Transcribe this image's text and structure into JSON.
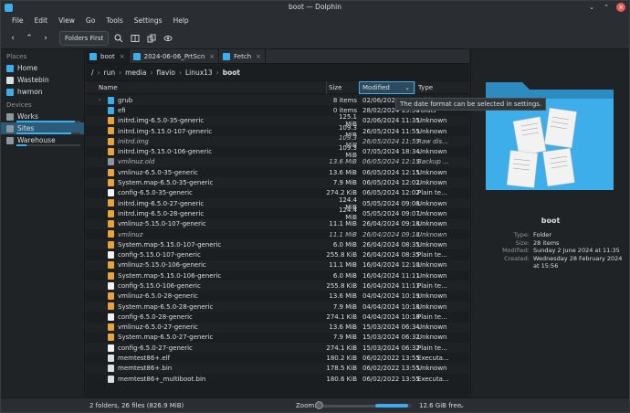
{
  "window": {
    "title": "boot — Dolphin"
  },
  "menu": [
    "File",
    "Edit",
    "View",
    "Go",
    "Tools",
    "Settings",
    "Help"
  ],
  "toolbar": {
    "folders_first_label": "Folders First"
  },
  "places": {
    "places_heading": "Places",
    "items": [
      {
        "label": "Home",
        "color": "#3daee9"
      },
      {
        "label": "Wastebin",
        "color": "#dcdfe2"
      },
      {
        "label": "hwmon",
        "color": "#3daee9"
      }
    ],
    "devices_heading": "Devices",
    "devices": [
      {
        "label": "Works",
        "usage": 0.92
      },
      {
        "label": "Sites",
        "usage": 0.85
      },
      {
        "label": "Warehouse",
        "usage": 0.15
      }
    ]
  },
  "tabs": [
    {
      "label": "boot"
    },
    {
      "label": "2024-06-06_PrtScn"
    },
    {
      "label": "Fetch"
    }
  ],
  "breadcrumb": [
    "/",
    "run",
    "media",
    "flavio",
    "Linux13",
    "boot"
  ],
  "columns": {
    "name": "Name",
    "size": "Size",
    "modified": "Modified",
    "type": "Type"
  },
  "tooltip": "The date format can be selected in settings.",
  "files": [
    {
      "name": "grub",
      "size": "8 items",
      "date": "02/06/2024 11:35",
      "type": "Folder",
      "kind": "folder",
      "dim": false,
      "expand": true
    },
    {
      "name": "efi",
      "size": "0 items",
      "date": "28/02/2024 15:56",
      "type": "Folder",
      "kind": "folder",
      "dim": false,
      "expand": false
    },
    {
      "name": "initrd.img-6.5.0-35-generic",
      "size": "125.1 MiB",
      "date": "02/06/2024 11:35",
      "type": "Unknown",
      "kind": "bin",
      "dim": false,
      "expand": false
    },
    {
      "name": "initrd.img-5.15.0-107-generic",
      "size": "109.3 MiB",
      "date": "26/05/2024 11:55",
      "type": "Unknown",
      "kind": "bin",
      "dim": false,
      "expand": false
    },
    {
      "name": "initrd.img",
      "size": "109.3 MiB",
      "date": "26/05/2024 11:55",
      "type": "Raw dis...",
      "kind": "bin",
      "dim": true,
      "expand": false
    },
    {
      "name": "initrd.img-5.15.0-106-generic",
      "size": "109.3 MiB",
      "date": "07/05/2024 18:34",
      "type": "Unknown",
      "kind": "bin",
      "dim": false,
      "expand": false
    },
    {
      "name": "vmlinuz.old",
      "size": "13.6 MiB",
      "date": "06/05/2024 12:15",
      "type": "Backup ...",
      "kind": "grey",
      "dim": true,
      "expand": false
    },
    {
      "name": "vmlinuz-6.5.0-35-generic",
      "size": "13.6 MiB",
      "date": "06/05/2024 12:15",
      "type": "Unknown",
      "kind": "bin",
      "dim": false,
      "expand": false
    },
    {
      "name": "System.map-6.5.0-35-generic",
      "size": "7.9 MiB",
      "date": "06/05/2024 12:02",
      "type": "Unknown",
      "kind": "bin",
      "dim": false,
      "expand": false
    },
    {
      "name": "config-6.5.0-35-generic",
      "size": "274.2 KiB",
      "date": "06/05/2024 12:02",
      "type": "Plain te...",
      "kind": "text",
      "dim": false,
      "expand": false
    },
    {
      "name": "initrd.img-6.5.0-27-generic",
      "size": "124.4 MiB",
      "date": "05/05/2024 09:08",
      "type": "Unknown",
      "kind": "bin",
      "dim": false,
      "expand": false
    },
    {
      "name": "initrd.img-6.5.0-28-generic",
      "size": "124.4 MiB",
      "date": "05/05/2024 09:07",
      "type": "Unknown",
      "kind": "bin",
      "dim": false,
      "expand": false
    },
    {
      "name": "vmlinuz-5.15.0-107-generic",
      "size": "11.1 MiB",
      "date": "26/04/2024 09:18",
      "type": "Unknown",
      "kind": "bin",
      "dim": false,
      "expand": false
    },
    {
      "name": "vmlinuz",
      "size": "11.1 MiB",
      "date": "26/04/2024 09:18",
      "type": "Unknown",
      "kind": "bin",
      "dim": true,
      "expand": false
    },
    {
      "name": "System.map-5.15.0-107-generic",
      "size": "6.0 MiB",
      "date": "26/04/2024 08:35",
      "type": "Unknown",
      "kind": "bin",
      "dim": false,
      "expand": false
    },
    {
      "name": "config-5.15.0-107-generic",
      "size": "255.8 KiB",
      "date": "26/04/2024 08:35",
      "type": "Plain te...",
      "kind": "text",
      "dim": false,
      "expand": false
    },
    {
      "name": "vmlinuz-5.15.0-106-generic",
      "size": "11.1 MiB",
      "date": "16/04/2024 12:10",
      "type": "Unknown",
      "kind": "bin",
      "dim": false,
      "expand": false
    },
    {
      "name": "System.map-5.15.0-106-generic",
      "size": "6.0 MiB",
      "date": "16/04/2024 11:11",
      "type": "Unknown",
      "kind": "bin",
      "dim": false,
      "expand": false
    },
    {
      "name": "config-5.15.0-106-generic",
      "size": "255.8 KiB",
      "date": "16/04/2024 11:11",
      "type": "Plain te...",
      "kind": "text",
      "dim": false,
      "expand": false
    },
    {
      "name": "vmlinuz-6.5.0-28-generic",
      "size": "13.6 MiB",
      "date": "04/04/2024 10:19",
      "type": "Unknown",
      "kind": "bin",
      "dim": false,
      "expand": false
    },
    {
      "name": "System.map-6.5.0-28-generic",
      "size": "7.9 MiB",
      "date": "04/04/2024 10:18",
      "type": "Unknown",
      "kind": "bin",
      "dim": false,
      "expand": false
    },
    {
      "name": "config-6.5.0-28-generic",
      "size": "274.1 KiB",
      "date": "04/04/2024 10:18",
      "type": "Plain te...",
      "kind": "text",
      "dim": false,
      "expand": false
    },
    {
      "name": "vmlinuz-6.5.0-27-generic",
      "size": "13.6 MiB",
      "date": "15/03/2024 06:34",
      "type": "Unknown",
      "kind": "bin",
      "dim": false,
      "expand": false
    },
    {
      "name": "System.map-6.5.0-27-generic",
      "size": "7.9 MiB",
      "date": "15/03/2024 06:32",
      "type": "Unknown",
      "kind": "bin",
      "dim": false,
      "expand": false
    },
    {
      "name": "config-6.5.0-27-generic",
      "size": "274.1 KiB",
      "date": "15/03/2024 06:32",
      "type": "Plain te...",
      "kind": "text",
      "dim": false,
      "expand": false
    },
    {
      "name": "memtest86+.elf",
      "size": "180.2 KiB",
      "date": "06/02/2022 13:55",
      "type": "Executa...",
      "kind": "exec",
      "dim": false,
      "expand": false
    },
    {
      "name": "memtest86+.bin",
      "size": "178.5 KiB",
      "date": "06/02/2022 13:55",
      "type": "Unknown",
      "kind": "exec",
      "dim": false,
      "expand": false
    },
    {
      "name": "memtest86+_multiboot.bin",
      "size": "180.6 KiB",
      "date": "06/02/2022 13:55",
      "type": "Executa...",
      "kind": "exec",
      "dim": false,
      "expand": false
    }
  ],
  "info": {
    "name": "boot",
    "rows": [
      {
        "k": "Type:",
        "v": "Folder"
      },
      {
        "k": "Size:",
        "v": "28 items"
      },
      {
        "k": "Modified:",
        "v": "Sunday 2 June 2024 at 11:35"
      },
      {
        "k": "Created:",
        "v": "Wednesday 28 February 2024 at 15:56"
      }
    ]
  },
  "status": {
    "summary": "2 folders, 26 files (826.9 MiB)",
    "zoom_label": "Zoom:",
    "free": "12.6 GiB free",
    "free_usage": 0.9
  },
  "colors": {
    "accent": "#3daee9",
    "folder": "#3daee9",
    "bin": "#e8a33d"
  }
}
